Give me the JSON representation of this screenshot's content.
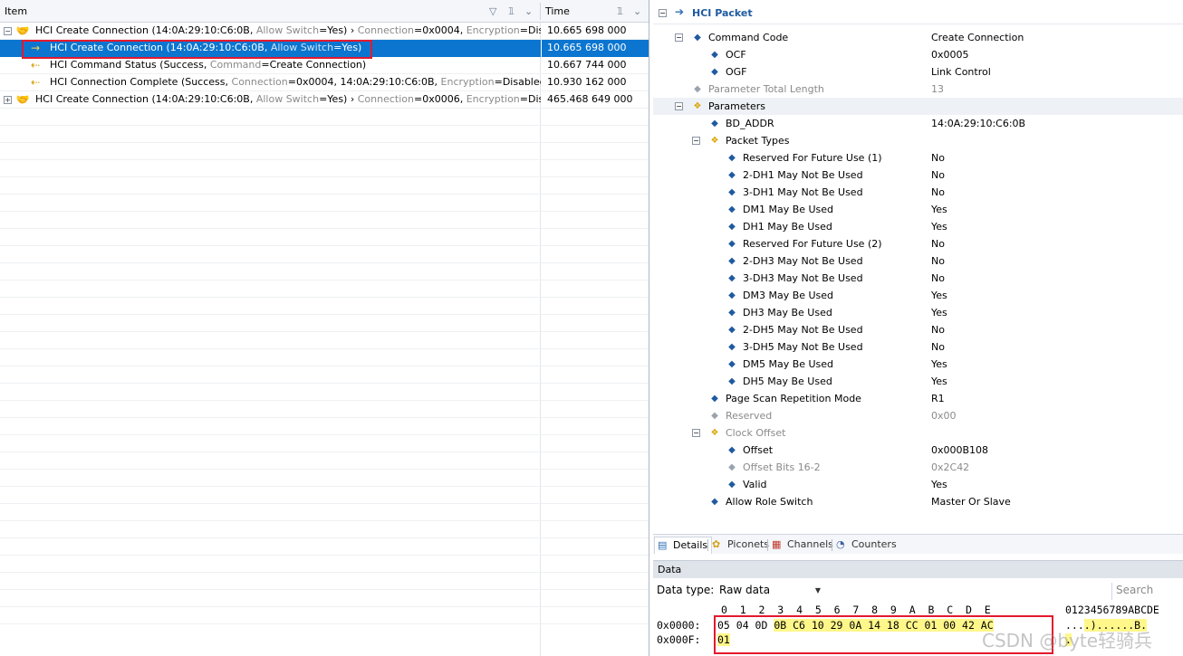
{
  "left_pane": {
    "columns": {
      "item": "Item",
      "time": "Time"
    },
    "rows": [
      {
        "expander": "−",
        "icon": "handshake-icon",
        "indent": 0,
        "main": "HCI Create Connection (14:0A:29:10:C6:0B, ",
        "dim1": "Allow Switch",
        "mid": "=Yes) › ",
        "dim2": "Connection",
        "mid2": "=0x0004, ",
        "dim3": "Encryption",
        "end": "=Disabled",
        "time": "10.665 698 000",
        "selected": false
      },
      {
        "expander": "",
        "icon": "arrow-right-icon",
        "indent": 1,
        "main": "HCI Create Connection (14:0A:29:10:C6:0B, ",
        "dim1": "Allow Switch",
        "mid": "=Yes)",
        "dim2": "",
        "mid2": "",
        "dim3": "",
        "end": "",
        "time": "10.665 698 000",
        "selected": true
      },
      {
        "expander": "",
        "icon": "arrow-left-lightning-icon",
        "indent": 1,
        "main": "HCI Command Status (Success, ",
        "dim1": "Command",
        "mid": "=Create Connection)",
        "dim2": "",
        "mid2": "",
        "dim3": "",
        "end": "",
        "time": "10.667 744 000",
        "selected": false
      },
      {
        "expander": "",
        "icon": "arrow-left-lightning-icon",
        "indent": 1,
        "main": "HCI Connection Complete (Success, ",
        "dim1": "Connection",
        "mid": "=0x0004, 14:0A:29:10:C6:0B, ",
        "dim2": "Encryption",
        "mid2": "=Disabled)",
        "dim3": "",
        "end": "",
        "time": "10.930 162 000",
        "selected": false
      },
      {
        "expander": "+",
        "icon": "handshake-icon",
        "indent": 0,
        "main": "HCI Create Connection (14:0A:29:10:C6:0B, ",
        "dim1": "Allow Switch",
        "mid": "=Yes) › ",
        "dim2": "Connection",
        "mid2": "=0x0006, ",
        "dim3": "Encryption",
        "end": "=Disabled",
        "time": "465.468 649 000",
        "selected": false
      }
    ]
  },
  "right_pane": {
    "header_expander": "−",
    "title": "HCI Packet",
    "tree": [
      {
        "level": 0,
        "exp": "−",
        "icon": "diamond-icon",
        "label": "Command Code",
        "value": "Create Connection",
        "grey": false,
        "band": false
      },
      {
        "level": 1,
        "exp": "",
        "icon": "diamond-icon",
        "label": "OCF",
        "value": "0x0005",
        "grey": false,
        "band": false
      },
      {
        "level": 1,
        "exp": "",
        "icon": "diamond-icon",
        "label": "OGF",
        "value": "Link Control",
        "grey": false,
        "band": false
      },
      {
        "level": 0,
        "exp": "",
        "icon": "diamond-icon",
        "label": "Parameter Total Length",
        "value": "13",
        "grey": true,
        "band": false
      },
      {
        "level": 0,
        "exp": "−",
        "icon": "diamond-group-icon",
        "label": "Parameters",
        "value": "",
        "grey": false,
        "band": true
      },
      {
        "level": 1,
        "exp": "",
        "icon": "diamond-icon",
        "label": "BD_ADDR",
        "value": "14:0A:29:10:C6:0B",
        "grey": false,
        "band": false
      },
      {
        "level": 1,
        "exp": "−",
        "icon": "diamond-group-icon",
        "label": "Packet Types",
        "value": "",
        "grey": false,
        "band": false
      },
      {
        "level": 2,
        "exp": "",
        "icon": "diamond-icon",
        "label": "Reserved For Future Use (1)",
        "value": "No",
        "grey": false,
        "band": false
      },
      {
        "level": 2,
        "exp": "",
        "icon": "diamond-icon",
        "label": "2-DH1 May Not Be Used",
        "value": "No",
        "grey": false,
        "band": false
      },
      {
        "level": 2,
        "exp": "",
        "icon": "diamond-icon",
        "label": "3-DH1 May Not Be Used",
        "value": "No",
        "grey": false,
        "band": false
      },
      {
        "level": 2,
        "exp": "",
        "icon": "diamond-icon",
        "label": "DM1 May Be Used",
        "value": "Yes",
        "grey": false,
        "band": false
      },
      {
        "level": 2,
        "exp": "",
        "icon": "diamond-icon",
        "label": "DH1 May Be Used",
        "value": "Yes",
        "grey": false,
        "band": false
      },
      {
        "level": 2,
        "exp": "",
        "icon": "diamond-icon",
        "label": "Reserved For Future Use (2)",
        "value": "No",
        "grey": false,
        "band": false
      },
      {
        "level": 2,
        "exp": "",
        "icon": "diamond-icon",
        "label": "2-DH3 May Not Be Used",
        "value": "No",
        "grey": false,
        "band": false
      },
      {
        "level": 2,
        "exp": "",
        "icon": "diamond-icon",
        "label": "3-DH3 May Not Be Used",
        "value": "No",
        "grey": false,
        "band": false
      },
      {
        "level": 2,
        "exp": "",
        "icon": "diamond-icon",
        "label": "DM3 May Be Used",
        "value": "Yes",
        "grey": false,
        "band": false
      },
      {
        "level": 2,
        "exp": "",
        "icon": "diamond-icon",
        "label": "DH3 May Be Used",
        "value": "Yes",
        "grey": false,
        "band": false
      },
      {
        "level": 2,
        "exp": "",
        "icon": "diamond-icon",
        "label": "2-DH5 May Not Be Used",
        "value": "No",
        "grey": false,
        "band": false
      },
      {
        "level": 2,
        "exp": "",
        "icon": "diamond-icon",
        "label": "3-DH5 May Not Be Used",
        "value": "No",
        "grey": false,
        "band": false
      },
      {
        "level": 2,
        "exp": "",
        "icon": "diamond-icon",
        "label": "DM5 May Be Used",
        "value": "Yes",
        "grey": false,
        "band": false
      },
      {
        "level": 2,
        "exp": "",
        "icon": "diamond-icon",
        "label": "DH5 May Be Used",
        "value": "Yes",
        "grey": false,
        "band": false
      },
      {
        "level": 1,
        "exp": "",
        "icon": "diamond-icon",
        "label": "Page Scan Repetition Mode",
        "value": "R1",
        "grey": false,
        "band": false
      },
      {
        "level": 1,
        "exp": "",
        "icon": "diamond-icon",
        "label": "Reserved",
        "value": "0x00",
        "grey": true,
        "band": false
      },
      {
        "level": 1,
        "exp": "−",
        "icon": "diamond-group-icon",
        "label": "Clock Offset",
        "value": "",
        "grey": true,
        "band": false
      },
      {
        "level": 2,
        "exp": "",
        "icon": "diamond-icon",
        "label": "Offset",
        "value": "0x000B108",
        "grey": false,
        "band": false
      },
      {
        "level": 2,
        "exp": "",
        "icon": "diamond-icon",
        "label": "Offset Bits 16-2",
        "value": "0x2C42",
        "grey": true,
        "band": false
      },
      {
        "level": 2,
        "exp": "",
        "icon": "diamond-icon",
        "label": "Valid",
        "value": "Yes",
        "grey": false,
        "band": false
      },
      {
        "level": 1,
        "exp": "",
        "icon": "diamond-icon",
        "label": "Allow Role Switch",
        "value": "Master Or Slave",
        "grey": false,
        "band": false
      }
    ],
    "tabs": [
      {
        "label": "Details",
        "icon": "details-icon",
        "active": true
      },
      {
        "label": "Piconets",
        "icon": "piconets-icon",
        "active": false
      },
      {
        "label": "Channels",
        "icon": "channels-icon",
        "active": false
      },
      {
        "label": "Counters",
        "icon": "counters-icon",
        "active": false
      }
    ],
    "data_section": {
      "header": "Data",
      "type_label": "Data type:",
      "type_value": "Raw data",
      "search_placeholder": "Search",
      "column_header": "0  1  2  3  4  5  6  7  8  9  A  B  C  D  E",
      "ascii_header": "0123456789ABCDE",
      "rows": [
        {
          "addr": "0x0000:",
          "plain": "05 04 0D ",
          "highlight": "0B C6 10 29 0A 14 18 CC 01 00 42 AC",
          "ascii_plain": "...",
          "ascii_hl": ".)......B."
        },
        {
          "addr": "0x000F:",
          "plain": "",
          "highlight": "01",
          "ascii_plain": "",
          "ascii_hl": "."
        }
      ]
    }
  },
  "watermark": "CSDN @byte轻骑兵",
  "colors": {
    "selection": "#0b75cf",
    "highlight_box": "#e3192e",
    "hex_highlight": "#fff78a"
  }
}
